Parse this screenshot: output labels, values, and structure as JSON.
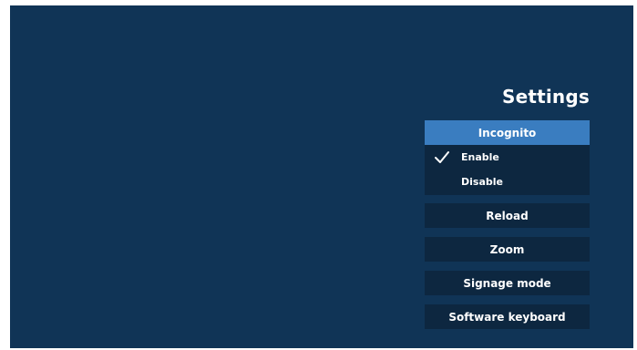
{
  "settings": {
    "title": "Settings",
    "header": "Incognito",
    "options": [
      {
        "label": "Enable",
        "checked": true
      },
      {
        "label": "Disable",
        "checked": false
      }
    ],
    "buttons": [
      {
        "label": "Reload"
      },
      {
        "label": "Zoom"
      },
      {
        "label": "Signage mode"
      },
      {
        "label": "Software keyboard"
      }
    ]
  },
  "colors": {
    "background": "#103456",
    "header_highlight": "#3a7dc0",
    "item_background": "#0d2740",
    "text": "#ffffff"
  },
  "icons": {
    "check": "check-icon"
  }
}
